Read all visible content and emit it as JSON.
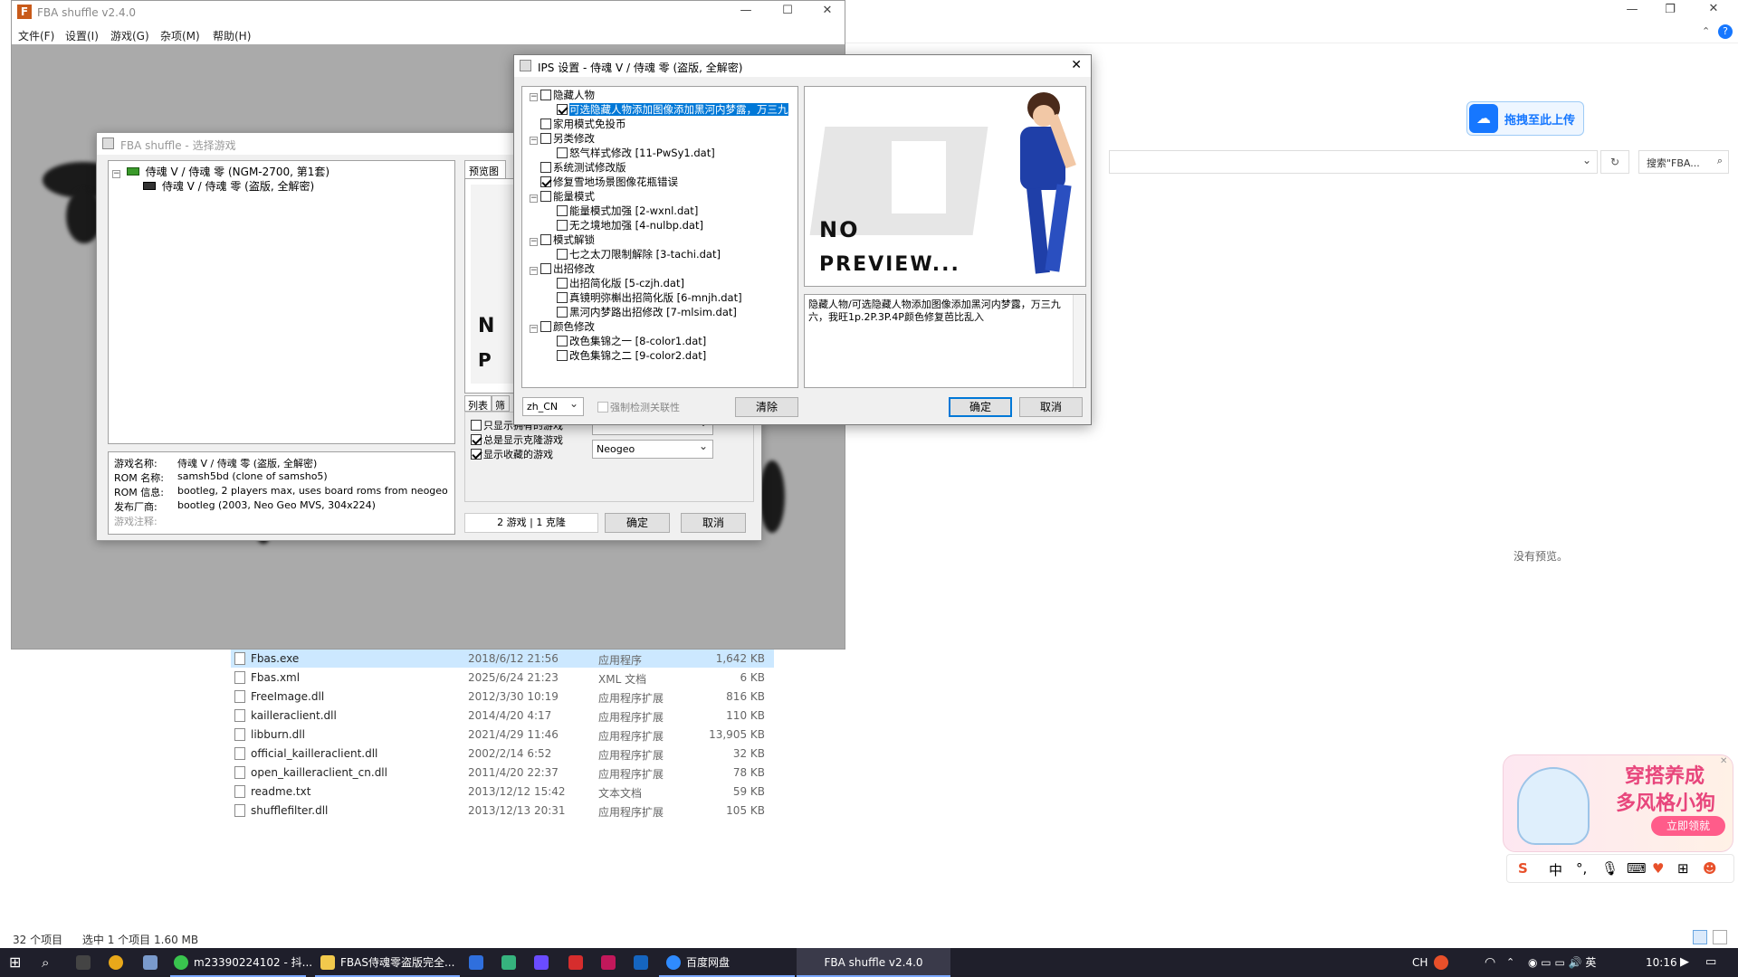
{
  "explorer": {
    "right_preview_text": "没有预览。",
    "upload_label": "拖拽至此上传",
    "search_placeholder": "搜索\"FBA...",
    "files": [
      {
        "name": "Fbas.exe",
        "date": "2018/6/12 21:56",
        "type": "应用程序",
        "size": "1,642 KB"
      },
      {
        "name": "Fbas.xml",
        "date": "2025/6/24 21:23",
        "type": "XML 文档",
        "size": "6 KB"
      },
      {
        "name": "FreeImage.dll",
        "date": "2012/3/30 10:19",
        "type": "应用程序扩展",
        "size": "816 KB"
      },
      {
        "name": "kailleraclient.dll",
        "date": "2014/4/20 4:17",
        "type": "应用程序扩展",
        "size": "110 KB"
      },
      {
        "name": "libburn.dll",
        "date": "2021/4/29 11:46",
        "type": "应用程序扩展",
        "size": "13,905 KB"
      },
      {
        "name": "official_kailleraclient.dll",
        "date": "2002/2/14 6:52",
        "type": "应用程序扩展",
        "size": "32 KB"
      },
      {
        "name": "open_kailleraclient_cn.dll",
        "date": "2011/4/20 22:37",
        "type": "应用程序扩展",
        "size": "78 KB"
      },
      {
        "name": "readme.txt",
        "date": "2013/12/12 15:42",
        "type": "文本文档",
        "size": "59 KB"
      },
      {
        "name": "shufflefilter.dll",
        "date": "2013/12/13 20:31",
        "type": "应用程序扩展",
        "size": "105 KB"
      }
    ],
    "status_count": "32 个项目",
    "status_selected": "选中 1 个项目  1.60 MB"
  },
  "ad": {
    "line1": "穿搭养成",
    "line2": "多风格小狗",
    "button": "立即领就"
  },
  "ime": {
    "lang": "中"
  },
  "main_window": {
    "title": "FBA shuffle v2.4.0",
    "menu": [
      "文件(F)",
      "设置(I)",
      "游戏(G)",
      "杂项(M)",
      "帮助(H)"
    ]
  },
  "select_dialog": {
    "title": "FBA shuffle - 选择游戏",
    "tree": [
      "侍魂 V / 侍魂 零 (NGM-2700, 第1套)",
      "侍魂 V / 侍魂 零 (盗版, 全解密)"
    ],
    "preview_tab": "预览图",
    "tab_list": "列表",
    "tab_other": "筛",
    "info_labels": [
      "游戏名称:",
      "ROM 名称:",
      "ROM 信息:",
      "发布厂商:",
      "游戏注释:"
    ],
    "info_values": [
      "侍魂 V / 侍魂 零 (盗版, 全解密)",
      "samsh5bd (clone of samsho5)",
      "bootleg, 2 players max, uses board roms from neogeo",
      "bootleg (2003, Neo Geo MVS, 304x224)",
      ""
    ],
    "options": [
      "只显示拥有的游戏",
      "总是显示克隆游戏",
      "显示收藏的游戏"
    ],
    "filter_combo": "Neogeo",
    "count_text": "2 游戏 | 1 克隆",
    "ok": "确定",
    "cancel": "取消"
  },
  "ips_dialog": {
    "title": "IPS 设置 - 侍魂 V / 侍魂 零 (盗版, 全解密)",
    "rows": [
      "隐藏人物",
      "可选隐藏人物添加图像添加黑河内梦露，万三九",
      "家用模式免投币",
      "另类修改",
      "怒气样式修改 [11-PwSy1.dat]",
      "系统测试修改版",
      "修复雪地场景图像花瓶错误",
      "能量模式",
      "能量模式加强 [2-wxnl.dat]",
      "无之境地加强 [4-nulbp.dat]",
      "模式解锁",
      "七之太刀限制解除 [3-tachi.dat]",
      "出招修改",
      "出招简化版 [5-czjh.dat]",
      "真镜明弥槲出招简化版 [6-mnjh.dat]",
      "黑河内梦路出招修改 [7-mlsim.dat]",
      "颜色修改",
      "改色集锦之一 [8-color1.dat]",
      "改色集锦之二 [9-color2.dat]"
    ],
    "preview_line1": "NO",
    "preview_line2": "PREVIEW...",
    "description": "隐藏人物/可选隐藏人物添加图像添加黑河内梦露，万三九六，我旺1p.2P.3P.4P颜色修复芭比乱入",
    "language": "zh_CN",
    "force_check": "强制检测关联性",
    "clear": "清除",
    "ok": "确定",
    "cancel": "取消"
  },
  "taskbar": {
    "items": [
      "m23390224102 - 抖...",
      "FBAS侍魂零盗版完全...",
      "百度网盘",
      "FBA shuffle v2.4.0"
    ],
    "ime_label": "CH",
    "clock": "10:16"
  },
  "colors": {
    "accent": "#0078d7",
    "taskbar": "#1f1f2b",
    "brand_pink": "#e8467c"
  }
}
